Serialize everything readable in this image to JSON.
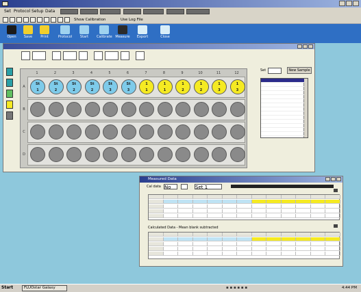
{
  "app": {
    "title": ""
  },
  "menubar": {
    "items": [
      "Set",
      "Protocol",
      "Setup",
      "Data"
    ]
  },
  "toolbar1": {
    "buttons": [
      "Show Calibration",
      "Use Log File"
    ]
  },
  "toolbar2": {
    "buttons": [
      "Open",
      "Save",
      "Print",
      "Protocol",
      "Start",
      "Calibrate",
      "Measure",
      "Export",
      "Close"
    ]
  },
  "plate": {
    "columns": [
      "1",
      "2",
      "3",
      "4",
      "5",
      "6",
      "7",
      "8",
      "9",
      "10",
      "11",
      "12"
    ],
    "rows": [
      "A",
      "B",
      "C",
      "D"
    ],
    "top_row": [
      {
        "line1": "St",
        "line2": "1",
        "color": "#7ecbea"
      },
      {
        "line1": "St",
        "line2": "2",
        "color": "#7ecbea"
      },
      {
        "line1": "St",
        "line2": "2",
        "color": "#7ecbea"
      },
      {
        "line1": "St",
        "line2": "2",
        "color": "#7ecbea"
      },
      {
        "line1": "St",
        "line2": "3",
        "color": "#7ecbea"
      },
      {
        "line1": "St",
        "line2": "3",
        "color": "#7ecbea"
      },
      {
        "line1": "1",
        "line2": "1",
        "color": "#f5ea22"
      },
      {
        "line1": "1",
        "line2": "1",
        "color": "#f5ea22"
      },
      {
        "line1": "1",
        "line2": "2",
        "color": "#f5ea22"
      },
      {
        "line1": "1",
        "line2": "2",
        "color": "#f5ea22"
      },
      {
        "line1": "1",
        "line2": "3",
        "color": "#f5ea22"
      },
      {
        "line1": "1",
        "line2": "3",
        "color": "#f5ea22"
      }
    ]
  },
  "side_panel": {
    "label": "Set",
    "button": "New Sample",
    "list_rows": 14
  },
  "measured_window": {
    "title": "Measured Data",
    "select_label": "Cal data",
    "select_value": "No",
    "select2_value": "Set 1",
    "section2": "Calculated Data - Mean blank subtracted"
  },
  "taskbar": {
    "start": "Start",
    "task": "FLUOstar Galaxy",
    "clock": "4:44 PM"
  }
}
